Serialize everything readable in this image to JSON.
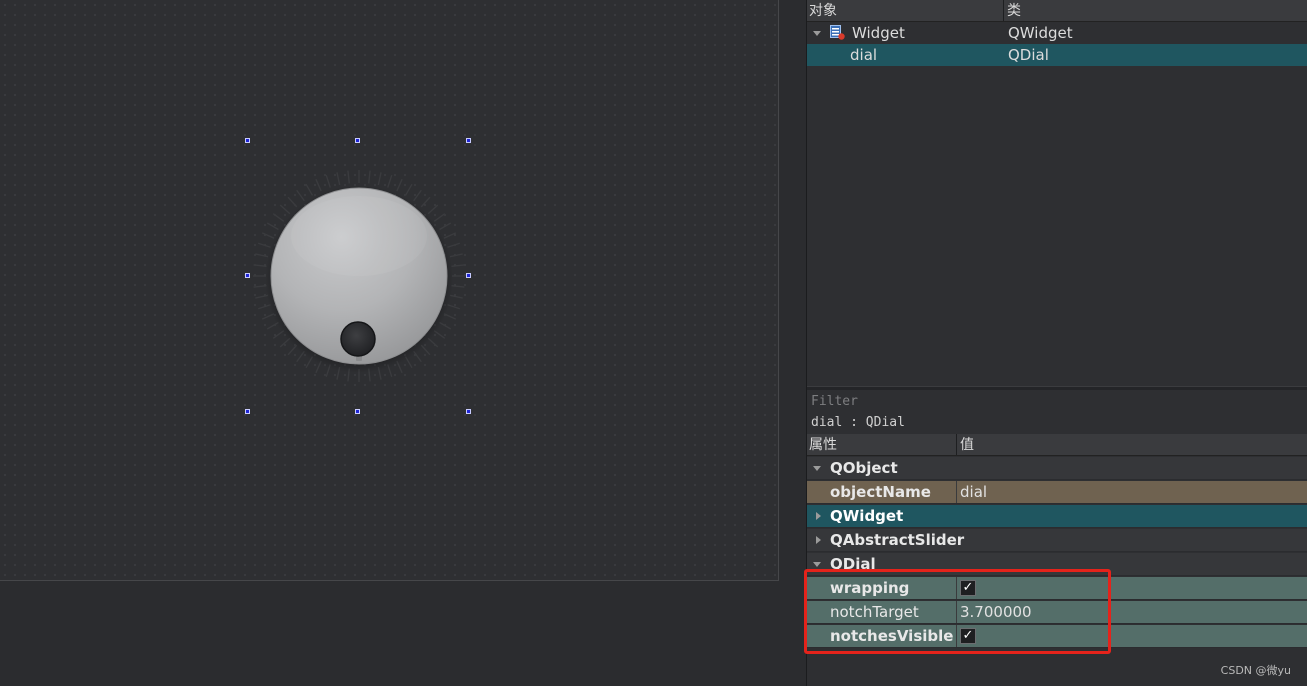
{
  "object_inspector": {
    "headers": {
      "object": "对象",
      "class": "类"
    },
    "rows": [
      {
        "object": "Widget",
        "class": "QWidget",
        "expanded": true,
        "selected": false,
        "icon": "widget-form-icon"
      },
      {
        "object": "dial",
        "class": "QDial",
        "selected": true
      }
    ]
  },
  "property_editor": {
    "filter_placeholder": "Filter",
    "object_label": "dial : QDial",
    "headers": {
      "property": "属性",
      "value": "值"
    },
    "groups": {
      "qobject": "QObject",
      "qwidget": "QWidget",
      "qabstractslider": "QAbstractSlider",
      "qdial": "QDial"
    },
    "properties": {
      "objectName": {
        "name": "objectName",
        "value": "dial"
      },
      "wrapping": {
        "name": "wrapping",
        "checked": true
      },
      "notchTarget": {
        "name": "notchTarget",
        "value": "3.700000"
      },
      "notchesVisible": {
        "name": "notchesVisible",
        "checked": true
      }
    }
  },
  "dial": {
    "notches_visible": true
  },
  "colors": {
    "highlight_border": "#e5231b",
    "group_text": "#e33b3b",
    "selected_row": "#1f5660",
    "objectname_row": "#6f6250",
    "qdial_prop_row": "#546e69"
  },
  "watermark": "CSDN @微yu"
}
